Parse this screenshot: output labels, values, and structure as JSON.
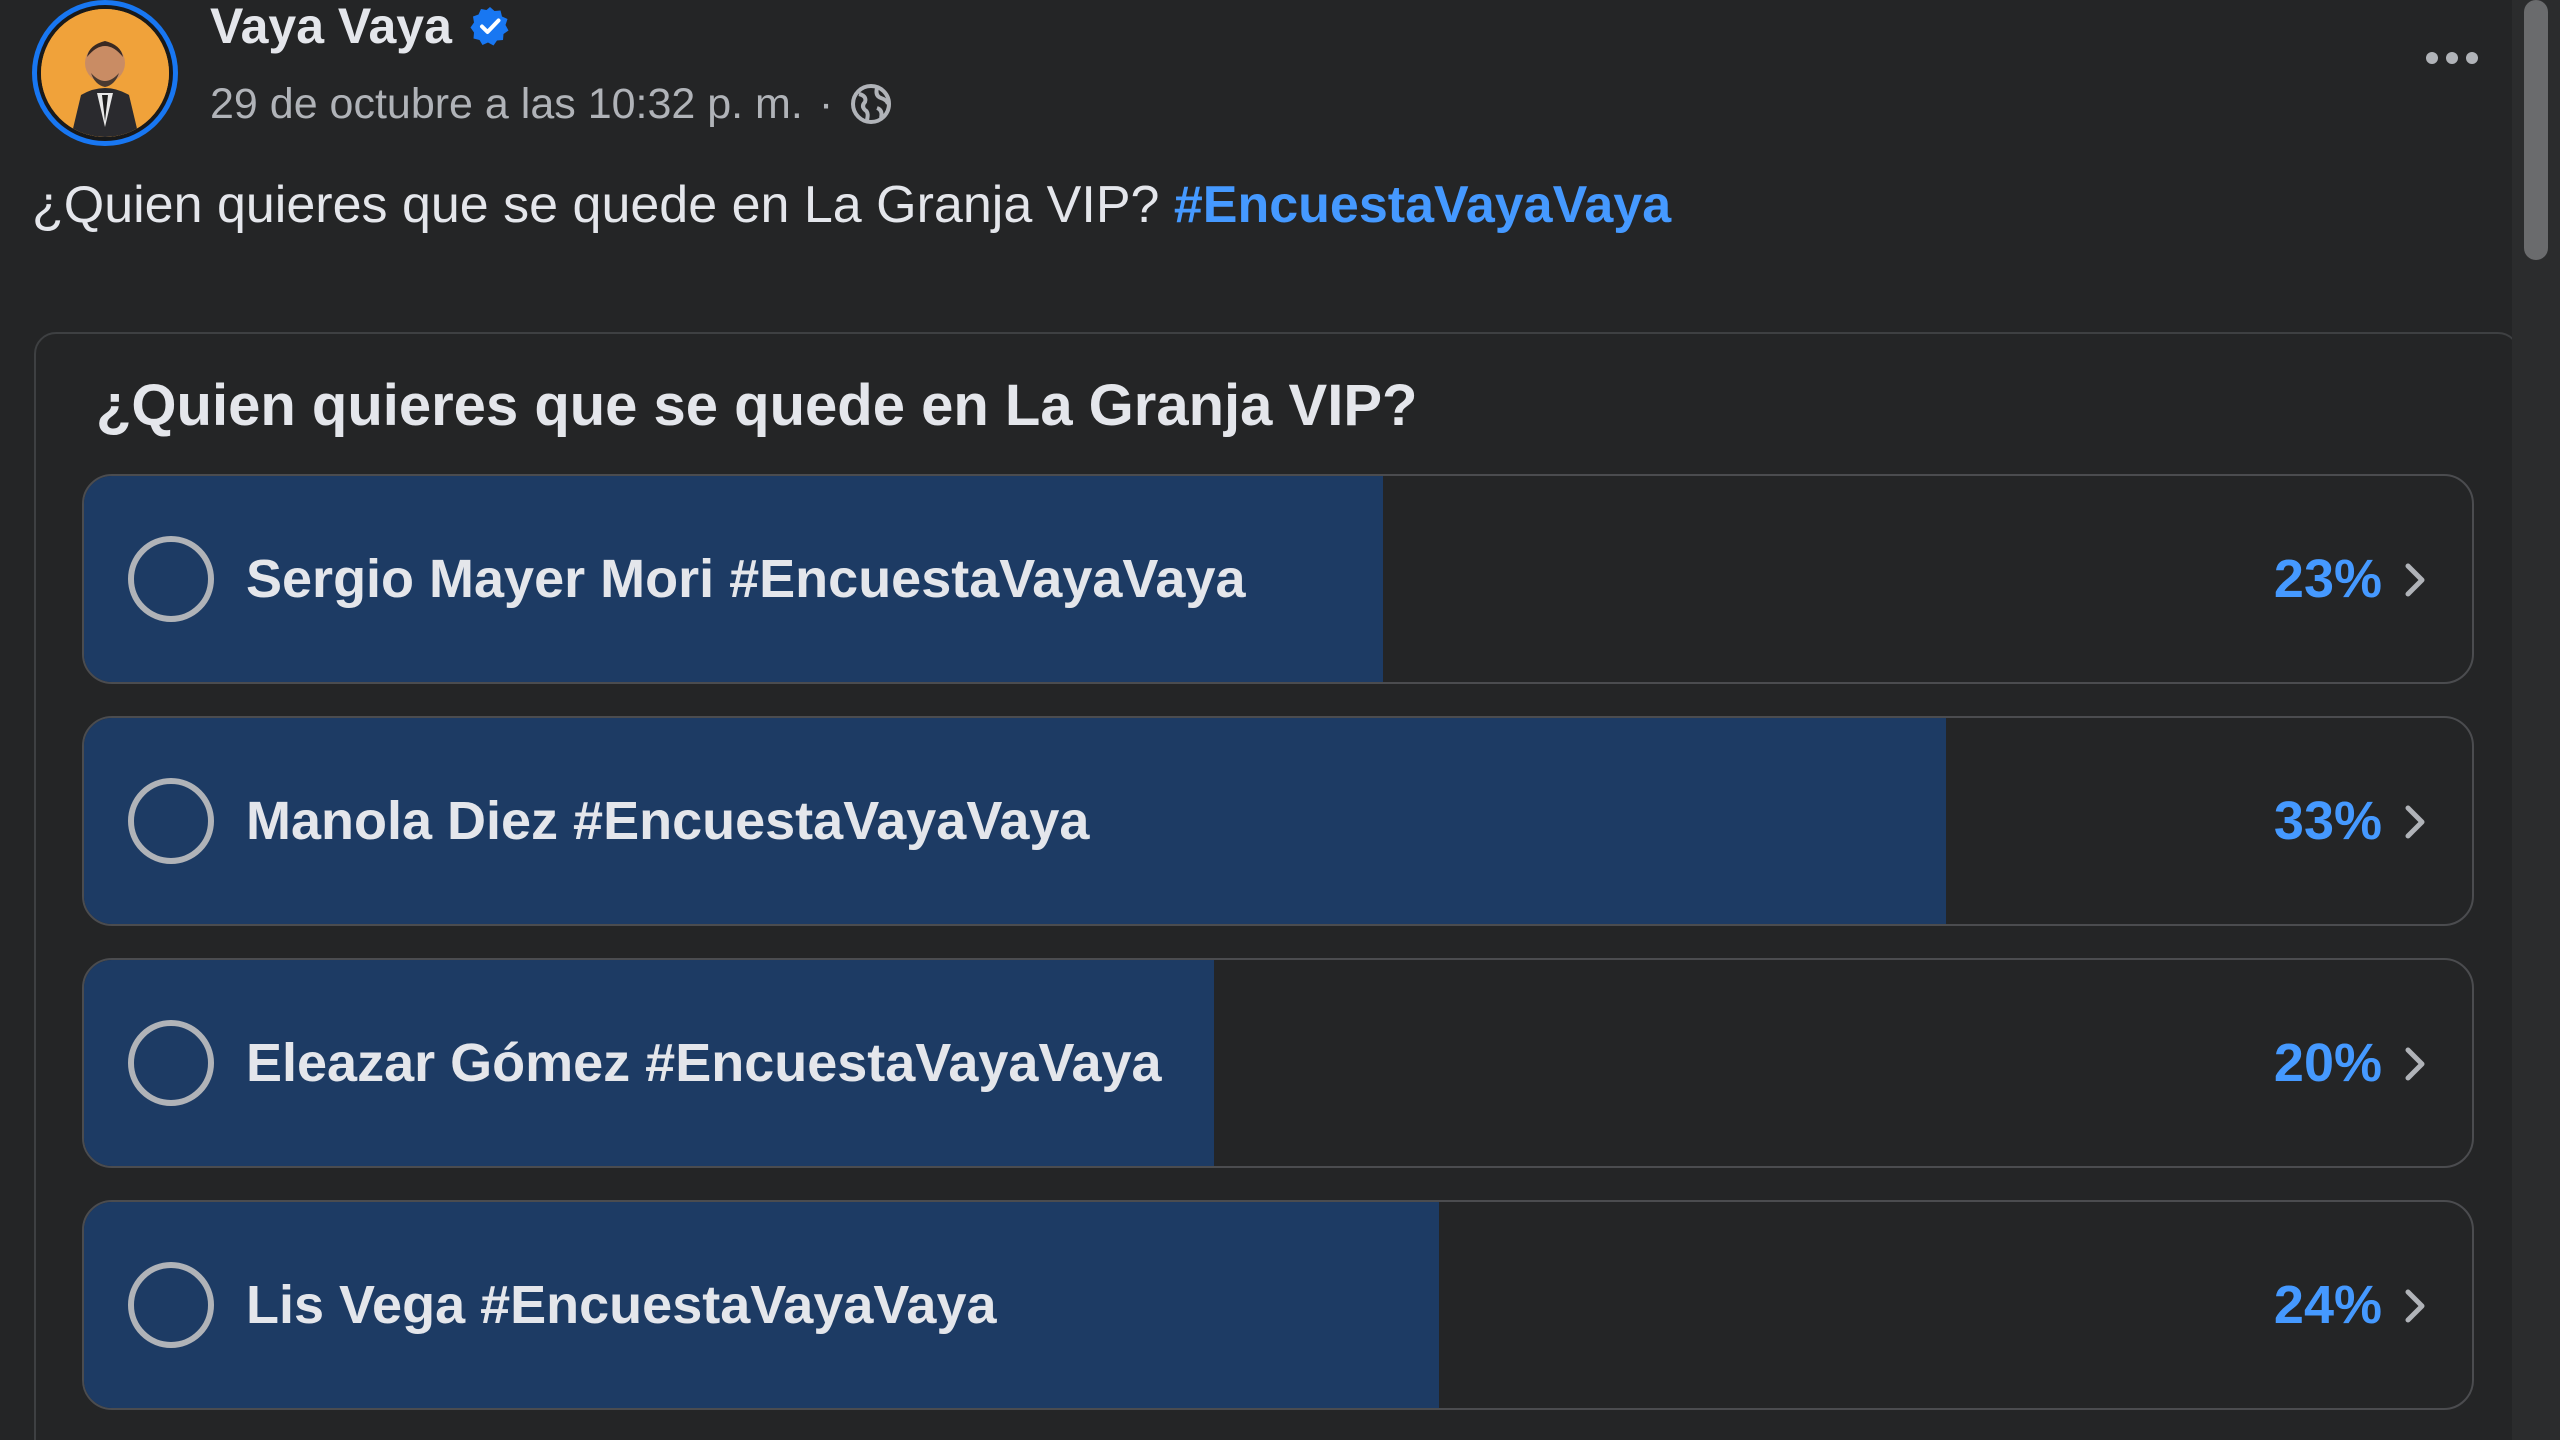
{
  "post": {
    "author": "Vaya Vaya",
    "timestamp": "29 de octubre a las 10:32 p. m.",
    "separator": "·",
    "privacy_icon": "globe-icon",
    "text": "¿Quien quieres que se quede en La Granja VIP?",
    "hashtag": "#EncuestaVayaVaya"
  },
  "poll": {
    "question": "¿Quien quieres que se quede en La Granja VIP?",
    "options": [
      {
        "label": "Sergio Mayer Mori #EncuestaVayaVaya",
        "percent_text": "23%",
        "percent": 23
      },
      {
        "label": "Manola Diez #EncuestaVayaVaya",
        "percent_text": "33%",
        "percent": 33
      },
      {
        "label": "Eleazar Gómez #EncuestaVayaVaya",
        "percent_text": "20%",
        "percent": 20
      },
      {
        "label": "Lis Vega #EncuestaVayaVaya",
        "percent_text": "24%",
        "percent": 24
      }
    ]
  },
  "colors": {
    "background": "#242526",
    "accent": "#4599ff",
    "bar_fill": "#1d3b64",
    "verified": "#1877f2"
  }
}
